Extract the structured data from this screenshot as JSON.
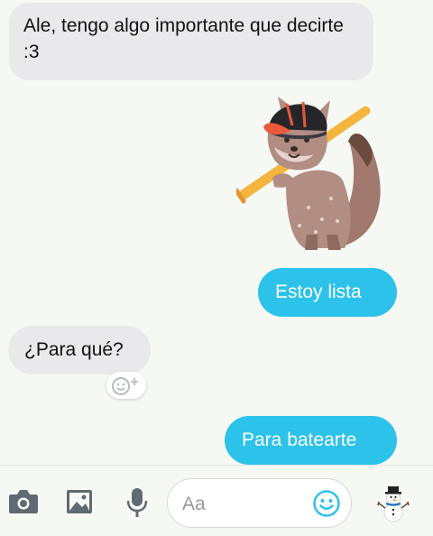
{
  "messages": [
    {
      "direction": "incoming",
      "text": "Ale, tengo algo importante que decirte :3"
    },
    {
      "direction": "outgoing",
      "text": "Estoy lista"
    },
    {
      "direction": "incoming",
      "text": "¿Para qué?"
    },
    {
      "direction": "outgoing",
      "text": "Para batearte"
    }
  ],
  "sticker": {
    "icon": "fox-with-baseball-bat-sticker"
  },
  "reaction": {
    "icon": "add-reaction-icon"
  },
  "composer": {
    "placeholder": "Aa",
    "tools": [
      "camera-icon",
      "gallery-icon",
      "microphone-icon"
    ],
    "emoji_icon": "smiley-icon",
    "sticker_icon": "snowman-icon"
  },
  "colors": {
    "accent": "#2cc2ea",
    "incoming_bubble": "#e9e9eb",
    "tool_gray": "#5f6b70",
    "background": "#f6f8f4"
  }
}
